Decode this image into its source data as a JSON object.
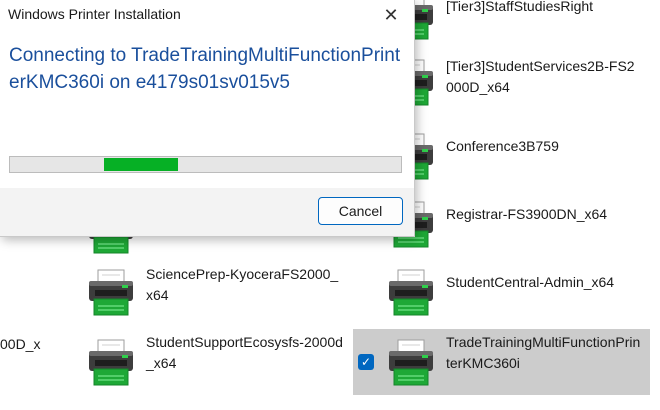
{
  "window": {
    "title": "Windows Printer Installation",
    "close_glyph": "✕",
    "heading": "Connecting to TradeTrainingMultiFunctionPrinterKMC360i on e4179s01sv015v5",
    "progress_fraction": 0.19,
    "progress_offset_fraction": 0.24,
    "cancel_label": "Cancel"
  },
  "printers": [
    {
      "label": "[Tier3]StaffStudiesRight",
      "icon": "printer-icon"
    },
    {
      "label": "[Tier3]StudentServices2B-FS2000D_x64",
      "icon": "printer-icon"
    },
    {
      "label": "Conference3B759",
      "icon": "printer-icon"
    },
    {
      "label": "Registrar-FS3900DN_x64",
      "icon": "printer-icon"
    },
    {
      "label": "SciencePrep-KyoceraFS2000_x64",
      "icon": "printer-icon"
    },
    {
      "label": "StudentCentral-Admin_x64",
      "icon": "printer-icon"
    },
    {
      "label": "StudentSupportEcosysfs-2000d_x64",
      "icon": "printer-icon"
    },
    {
      "label": "TradeTrainingMultiFunctionPrinterKMC360i",
      "icon": "printer-icon",
      "selected": true
    },
    {
      "label": "00D_x",
      "partial": true
    }
  ],
  "selection": {
    "check_glyph": "✓"
  },
  "colors": {
    "accent": "#0067c0",
    "heading": "#1a4f9c",
    "progress": "#06b025",
    "selected_bg": "#cccccc"
  }
}
